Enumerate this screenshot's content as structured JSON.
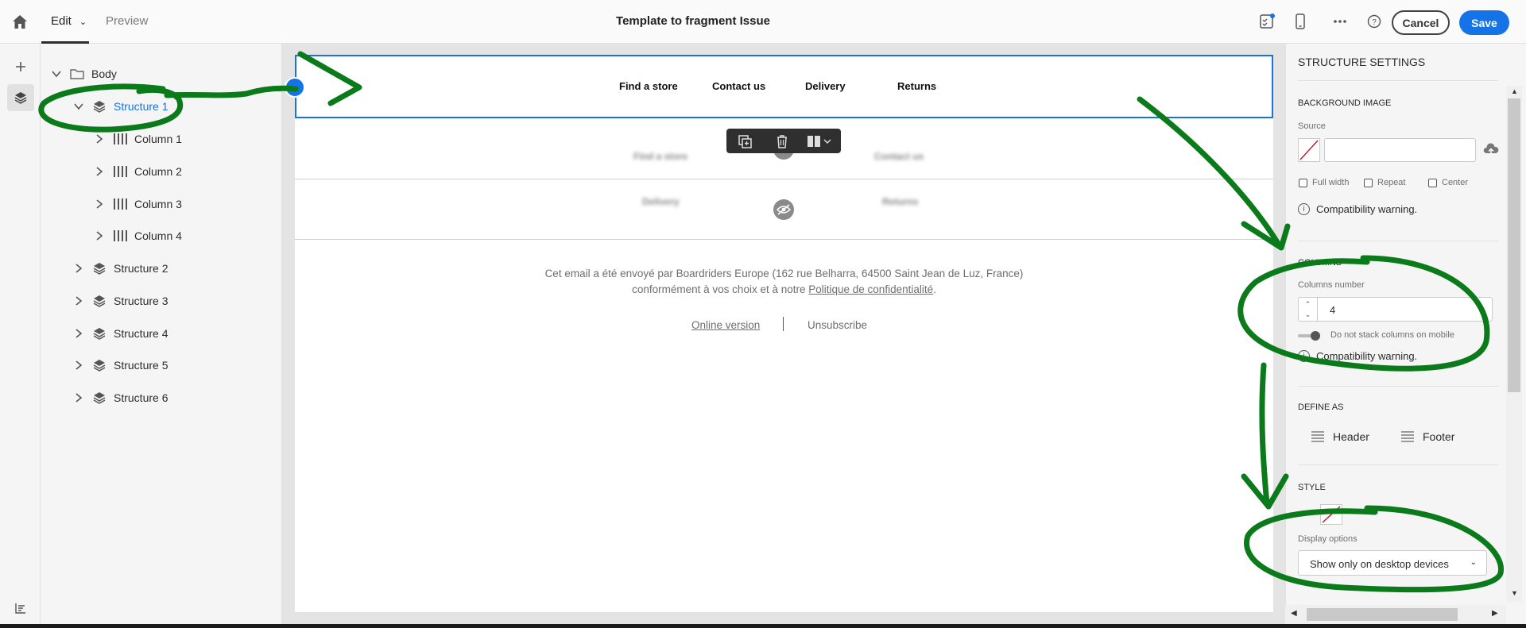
{
  "app": {
    "tabs": {
      "edit": "Edit",
      "preview": "Preview"
    },
    "title": "Template to fragment Issue",
    "cancel": "Cancel",
    "save": "Save"
  },
  "tree": {
    "body": "Body",
    "structure1": "Structure 1",
    "columns": [
      "Column 1",
      "Column 2",
      "Column 3",
      "Column 4"
    ],
    "structures": [
      "Structure 2",
      "Structure 3",
      "Structure 4",
      "Structure 5",
      "Structure 6"
    ]
  },
  "email": {
    "nav": [
      "Find a store",
      "Contact us",
      "Delivery",
      "Returns"
    ],
    "blurred_row1": [
      "Find a store",
      "Contact us"
    ],
    "blurred_row2": [
      "Delivery",
      "Returns"
    ],
    "footer_line1": "Cet email a été envoyé par Boardriders Europe (162 rue Belharra, 64500 Saint Jean de Luz, France)",
    "footer_line2_pre": "conformément à vos choix et à notre ",
    "footer_line2_link": "Politique de confidentialité",
    "footer_line2_post": ".",
    "online_version": "Online version",
    "unsubscribe": "Unsubscribe"
  },
  "settings": {
    "title": "STRUCTURE SETTINGS",
    "background_image": "BACKGROUND IMAGE",
    "source": "Source",
    "source_value": "",
    "full_width": "Full width",
    "repeat": "Repeat",
    "center": "Center",
    "compat_warning": "Compatibility warning.",
    "columns_section": "COLUMNS",
    "columns_number_label": "Columns number",
    "columns_number": "4",
    "no_stack": "Do not stack columns on mobile",
    "define_as": "DEFINE AS",
    "header": "Header",
    "footer": "Footer",
    "style": "STYLE",
    "display_options": "Display options",
    "display_value": "Show only on desktop devices"
  },
  "colors": {
    "accent": "#1473e6",
    "annotation": "#0a7a1a"
  }
}
